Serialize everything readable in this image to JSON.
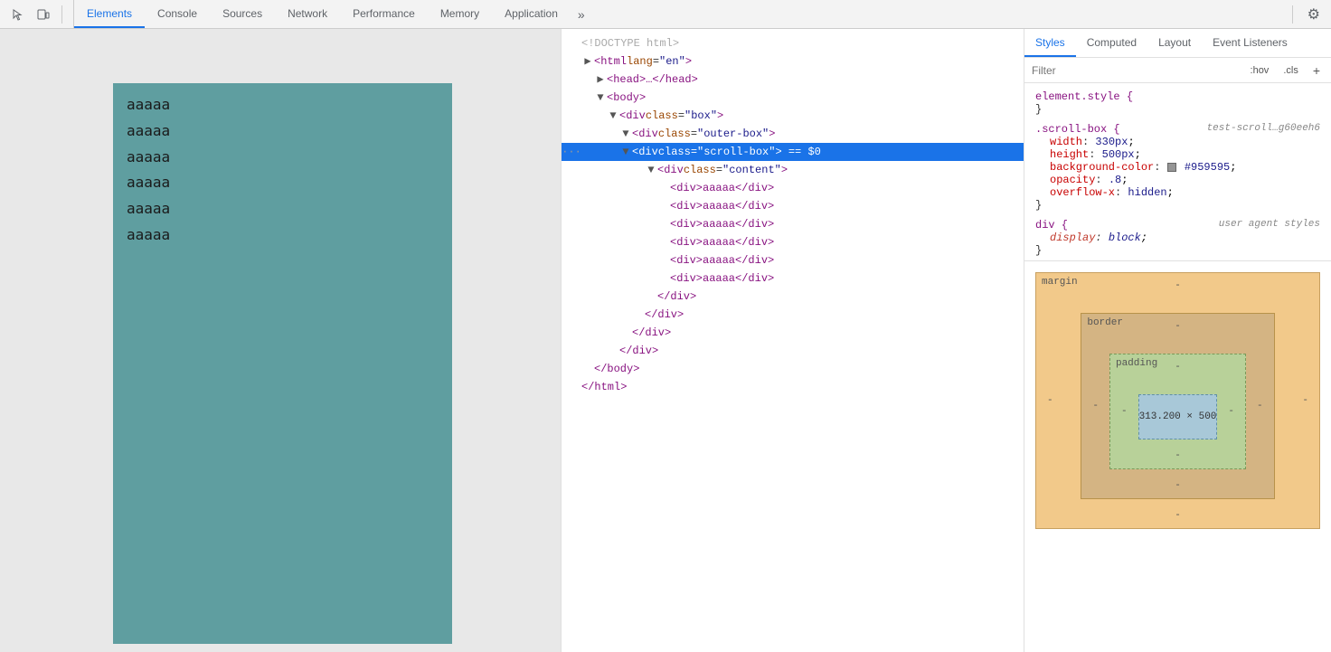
{
  "toolbar": {
    "icons": [
      "cursor-icon",
      "device-icon"
    ],
    "tabs": [
      {
        "label": "Elements",
        "active": true
      },
      {
        "label": "Console",
        "active": false
      },
      {
        "label": "Sources",
        "active": false
      },
      {
        "label": "Network",
        "active": false
      },
      {
        "label": "Performance",
        "active": false
      },
      {
        "label": "Memory",
        "active": false
      },
      {
        "label": "Application",
        "active": false
      }
    ],
    "overflow_label": "»",
    "settings_icon": "⚙"
  },
  "preview": {
    "items": [
      "aaaaa",
      "aaaaa",
      "aaaaa",
      "aaaaa",
      "aaaaa",
      "aaaaa"
    ]
  },
  "dom": {
    "lines": [
      {
        "indent": 0,
        "text": "<!DOCTYPE html>",
        "type": "comment"
      },
      {
        "indent": 0,
        "text": "<html lang=\"en\">",
        "type": "tag",
        "triangle": "▶",
        "collapsed": false
      },
      {
        "indent": 1,
        "text": "<head>…</head>",
        "type": "tag",
        "triangle": "▶"
      },
      {
        "indent": 1,
        "text": "<body>",
        "type": "tag",
        "triangle": "▼"
      },
      {
        "indent": 2,
        "text": "<div class=\"box\">",
        "type": "tag",
        "triangle": "▼"
      },
      {
        "indent": 3,
        "text": "<div class=\"outer-box\">",
        "type": "tag",
        "triangle": "▼"
      },
      {
        "indent": 4,
        "text": "<div class=\"scroll-box\"> == $0",
        "type": "tag",
        "triangle": "▼",
        "selected": true,
        "dots": "···"
      },
      {
        "indent": 5,
        "text": "<div class=\"content\">",
        "type": "tag",
        "triangle": "▼"
      },
      {
        "indent": 6,
        "text": "<div>aaaaa</div>",
        "type": "tag"
      },
      {
        "indent": 6,
        "text": "<div>aaaaa</div>",
        "type": "tag"
      },
      {
        "indent": 6,
        "text": "<div>aaaaa</div>",
        "type": "tag"
      },
      {
        "indent": 6,
        "text": "<div>aaaaa</div>",
        "type": "tag"
      },
      {
        "indent": 6,
        "text": "<div>aaaaa</div>",
        "type": "tag"
      },
      {
        "indent": 6,
        "text": "<div>aaaaa</div>",
        "type": "tag"
      },
      {
        "indent": 5,
        "text": "</div>",
        "type": "tag"
      },
      {
        "indent": 4,
        "text": "</div>",
        "type": "tag"
      },
      {
        "indent": 3,
        "text": "</div>",
        "type": "tag"
      },
      {
        "indent": 2,
        "text": "</div>",
        "type": "tag"
      },
      {
        "indent": 1,
        "text": "</body>",
        "type": "tag"
      },
      {
        "indent": 0,
        "text": "</html>",
        "type": "tag"
      }
    ]
  },
  "styles": {
    "tabs": [
      "Styles",
      "Computed",
      "Layout",
      "Event Listeners"
    ],
    "active_tab": "Styles",
    "filter_placeholder": "Filter",
    "pseudo_btn": ":hov",
    "cls_btn": ".cls",
    "add_btn": "+",
    "rules": [
      {
        "selector": "element.style",
        "source": "",
        "properties": [],
        "empty": true
      },
      {
        "selector": ".scroll-box {",
        "source": "test-scroll…g60eeh6",
        "properties": [
          {
            "name": "width",
            "value": "330px",
            "colon": ":"
          },
          {
            "name": "height",
            "value": "500px",
            "colon": ":"
          },
          {
            "name": "background-color",
            "value": "#959595",
            "colon": ":",
            "has_swatch": true
          },
          {
            "name": "opacity",
            "value": ".8",
            "colon": ":"
          },
          {
            "name": "overflow-x",
            "value": "hidden",
            "colon": ":"
          }
        ]
      },
      {
        "selector": "div {",
        "source": "user agent styles",
        "properties": [
          {
            "name": "display",
            "value": "block",
            "colon": ":"
          }
        ]
      }
    ],
    "box_model": {
      "margin_label": "margin",
      "border_label": "border",
      "padding_label": "padding",
      "content_size": "313.200 × 500",
      "margin_top": "-",
      "margin_right": "-",
      "margin_bottom": "-",
      "margin_left": "-",
      "border_top": "-",
      "border_right": "-",
      "border_bottom": "-",
      "border_left": "-",
      "padding_top": "-",
      "padding_right": "-",
      "padding_bottom": "-",
      "padding_left": "-"
    }
  }
}
